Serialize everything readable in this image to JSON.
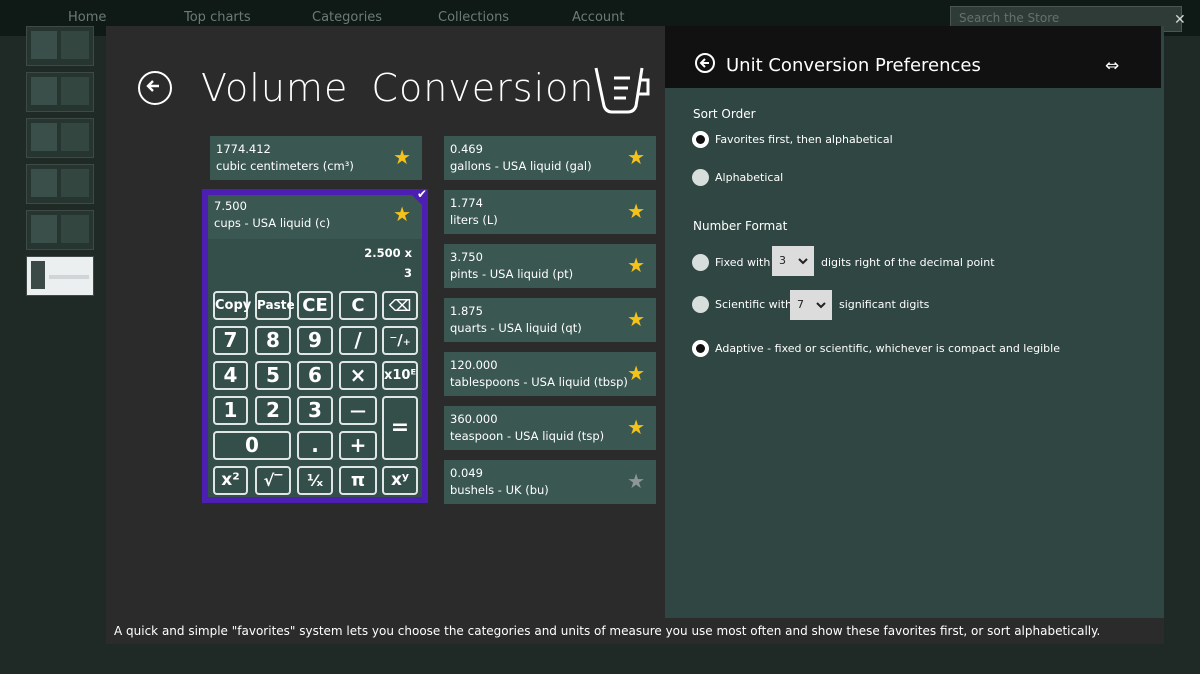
{
  "background": {
    "nav_items": [
      "Home",
      "Top charts",
      "Categories",
      "Collections",
      "Account"
    ],
    "search_placeholder": "Search the Store"
  },
  "app": {
    "title": "Volume  Conversion",
    "units_left": [
      {
        "value": "1774.412",
        "name": "cubic centimeters (cm³)",
        "favorite": true
      }
    ],
    "selected_unit": {
      "value": "7.500",
      "name": "cups - USA liquid (c)",
      "favorite": true
    },
    "calculator": {
      "expression_line1": "2.500  x",
      "expression_line2": "3",
      "keys": {
        "copy": "Copy",
        "paste": "Paste",
        "ce": "CE",
        "c": "C",
        "backspace": "⌫",
        "seven": "7",
        "eight": "8",
        "nine": "9",
        "divide": "/",
        "sign": "⁻∕₊",
        "four": "4",
        "five": "5",
        "six": "6",
        "multiply": "×",
        "exp": "x10ᴱ",
        "one": "1",
        "two": "2",
        "three": "3",
        "minus": "—",
        "equals": "=",
        "zero": "0",
        "dot": ".",
        "plus": "+",
        "square": "x²",
        "sqrt": "√‾",
        "reciprocal": "¹⁄ₓ",
        "pi": "π",
        "power": "xʸ"
      }
    },
    "units_right": [
      {
        "value": "0.469",
        "name": "gallons - USA liquid (gal)",
        "favorite": true
      },
      {
        "value": "1.774",
        "name": "liters (L)",
        "favorite": true
      },
      {
        "value": "3.750",
        "name": "pints - USA liquid (pt)",
        "favorite": true
      },
      {
        "value": "1.875",
        "name": "quarts - USA liquid (qt)",
        "favorite": true
      },
      {
        "value": "120.000",
        "name": "tablespoons - USA liquid (tbsp)",
        "favorite": true
      },
      {
        "value": "360.000",
        "name": "teaspoon - USA liquid (tsp)",
        "favorite": true
      },
      {
        "value": "0.049",
        "name": "bushels - UK (bu)",
        "favorite": false
      }
    ]
  },
  "prefs": {
    "title": "Unit Conversion Preferences",
    "sort_order": {
      "heading": "Sort Order",
      "options": [
        "Favorites first, then alphabetical",
        "Alphabetical"
      ],
      "selected": 0
    },
    "number_format": {
      "heading": "Number Format",
      "fixed_label": "Fixed with",
      "fixed_digits": "3",
      "fixed_suffix": "digits right of the decimal point",
      "scientific_label": "Scientific with",
      "scientific_digits": "7",
      "scientific_suffix": "significant digits",
      "adaptive_label": "Adaptive - fixed or scientific, whichever is compact and legible",
      "selected": 2
    }
  },
  "caption": "A quick and simple \"favorites\" system lets you choose the categories and units of measure you use most often and show these favorites first, or sort alphabetically.",
  "colors": {
    "tile": "#3a5752",
    "selection": "#4c1fb2",
    "star": "#f5c218",
    "pane": "#2f4642"
  }
}
